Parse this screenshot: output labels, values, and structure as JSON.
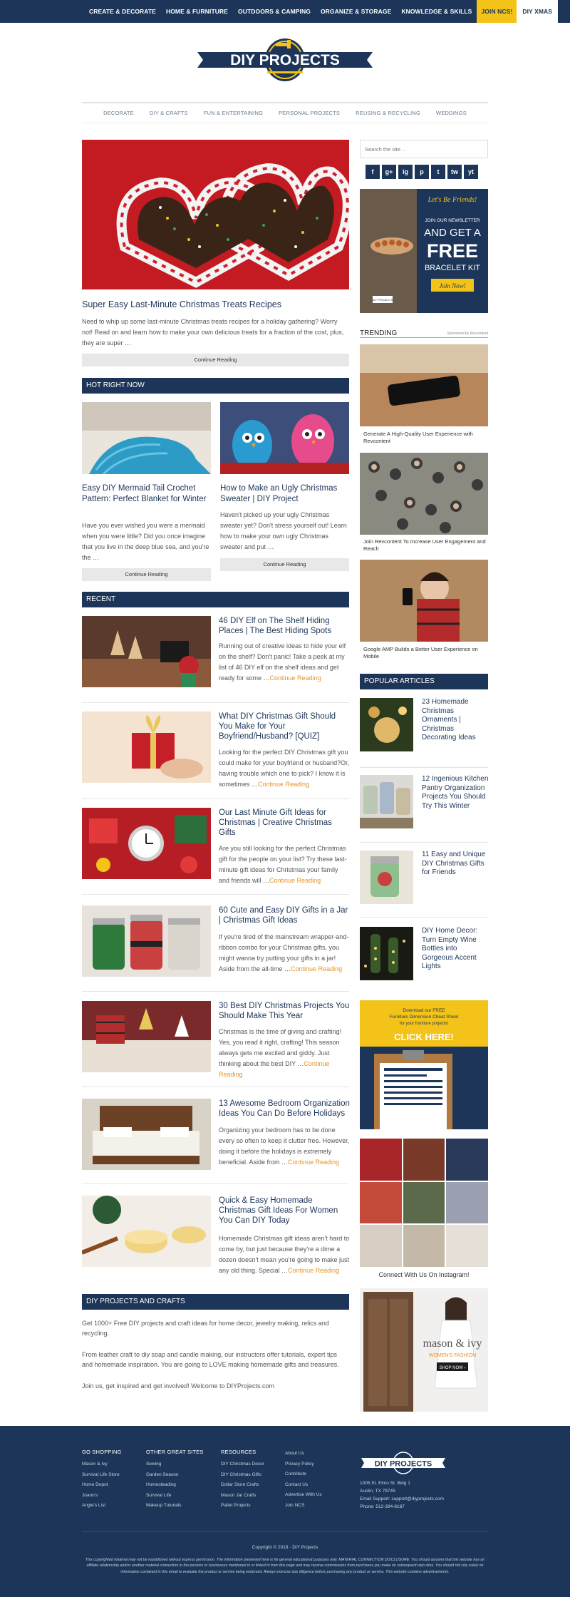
{
  "topnav": {
    "items": [
      "CREATE & DECORATE",
      "HOME & FURNITURE",
      "OUTDOORS & CAMPING",
      "ORGANIZE & STORAGE",
      "KNOWLEDGE & SKILLS"
    ],
    "join": "JOIN NCS!",
    "xmas": "DIY XMAS"
  },
  "logo": {
    "text": "DIY PROJECTS"
  },
  "mainnav": [
    "DECORATE",
    "DIY & CRAFTS",
    "FUN & ENTERTAINING",
    "PERSONAL PROJECTS",
    "REUSING & RECYCLING",
    "WEDDINGS"
  ],
  "hero": {
    "title": "Super Easy Last-Minute Christmas Treats Recipes",
    "excerpt": "Need to whip up some last-minute Christmas treats recipes for a holiday gathering? Worry not! Read on and learn how to make your own delicious treats for a fraction of the cost, plus, they are super …",
    "button": "Continue Reading"
  },
  "hot": {
    "heading": "HOT RIGHT NOW",
    "items": [
      {
        "title": "Easy DIY Mermaid Tail Crochet Pattern: Perfect Blanket for Winter",
        "excerpt": "Have you ever wished you were a mermaid when you were little? Did you once imagine that you live in the deep blue sea, and you're the …",
        "button": "Continue Reading"
      },
      {
        "title": "How to Make an Ugly Christmas Sweater | DIY Project",
        "excerpt": "Haven't picked up your ugly Christmas sweater yet? Don't stress yourself out! Learn how to make your own ugly Christmas sweater and put …",
        "button": "Continue Reading"
      }
    ]
  },
  "recent": {
    "heading": "RECENT",
    "items": [
      {
        "title": "46 DIY Elf on The Shelf Hiding Places | The Best Hiding Spots",
        "excerpt": "Running out of creative ideas to hide your elf on the shelf? Don't panic! Take a peek at my list of 46 DIY elf on the shelf ideas and get ready for some …",
        "more": "Continue Reading"
      },
      {
        "title": "What DIY Christmas Gift Should You Make for Your Boyfriend/Husband? [QUIZ]",
        "excerpt": "Looking for the perfect DIY Christmas gift you could make for your boyfriend or husband?Or, having trouble which one to pick? I know it is sometimes …",
        "more": "Continue Reading"
      },
      {
        "title": "Our Last Minute Gift Ideas for Christmas | Creative Christmas Gifts",
        "excerpt": "Are you still looking for the perfect Christmas gift for the people on your list? Try these last-minute gift ideas for Christmas your family and friends will …",
        "more": "Continue Reading"
      },
      {
        "title": "60 Cute and Easy DIY Gifts in a Jar | Christmas Gift Ideas",
        "excerpt": "If you're tired of the mainstream wrapper-and-ribbon combo for your Christmas gifts, you might wanna try putting your gifts in a jar! Aside from the all-time …",
        "more": "Continue Reading"
      },
      {
        "title": "30 Best DIY Christmas Projects You Should Make This Year",
        "excerpt": "Christmas is the time of giving and crafting! Yes, you read it right, crafting! This season always gets me excited and giddy. Just thinking about the best DIY …",
        "more": "Continue Reading"
      },
      {
        "title": "13 Awesome Bedroom Organization Ideas You Can Do Before Holidays",
        "excerpt": "Organizing your bedroom has to be done every so often to keep it clutter free. However, doing it before the holidays is extremely beneficial. Aside from …",
        "more": "Continue Reading"
      },
      {
        "title": "Quick & Easy Homemade Christmas Gift Ideas For Women You Can DIY Today",
        "excerpt": "Homemade Christmas gift ideas aren't hard to come by, but just because they're a dime a dozen doesn't mean you're going to make just any old thing. Special …",
        "more": "Continue Reading"
      }
    ]
  },
  "about": {
    "heading": "DIY PROJECTS AND CRAFTS",
    "p1": "Get 1000+ Free DIY projects and craft ideas for home decor, jewelry making, relics and recycling.",
    "p2": "From leather craft to diy soap and candle making, our instructors offer tutorials, expert tips and homemade inspiration. You are going to LOVE making homemade gifts and treasures.",
    "p3": "Join us, get inspired and get involved! Welcome to DIYProjects.com"
  },
  "sidebar": {
    "search_placeholder": "Search the site ..",
    "social": [
      "f",
      "g+",
      "ig",
      "p",
      "t",
      "tw",
      "yt"
    ],
    "ad_friends": {
      "line1": "Let's Be Friends!",
      "line2": "JOIN OUR NEWSLETTER",
      "line3": "AND GET A",
      "line4": "FREE",
      "line5": "BRACELET KIT",
      "cta": "Join Now!"
    },
    "trending": {
      "heading": "TRENDING",
      "sponsor": "Sponsored by Revcontent",
      "items": [
        "Generate A High-Quality User Experience with Revcontent",
        "Join Revcontent To Increase User Engagement and Reach",
        "Google AMP Builds a Better User Experience on Mobile"
      ]
    },
    "popular": {
      "heading": "POPULAR ARTICLES",
      "items": [
        "23 Homemade Christmas Ornaments | Christmas Decorating Ideas",
        "12 Ingenious Kitchen Pantry Organization Projects You Should Try This Winter",
        "11 Easy and Unique DIY Christmas Gifts for Friends",
        "DIY Home Decor: Turn Empty Wine Bottles into Gorgeous Accent Lights"
      ]
    },
    "ad_click": {
      "line1": "Download our FREE",
      "line2": "Furniture Dimension Cheat Sheet",
      "line3": "for your furniture projects!",
      "cta": "CLICK HERE!"
    },
    "instagram_caption": "Connect With Us On Instagram!",
    "ad_mason": {
      "brand": "mason & ivy",
      "sub": "WOMEN'S FASHION",
      "cta": "SHOP NOW ›"
    }
  },
  "footer": {
    "columns": [
      {
        "heading": "GO SHOPPING",
        "links": [
          "Mason & Ivy",
          "Survival Life Store",
          "Home Depot",
          "Joann's",
          "Angie's List"
        ]
      },
      {
        "heading": "OTHER GREAT SITES",
        "links": [
          "Sewing",
          "Garden Season",
          "Homesteading",
          "Survival Life",
          "Makeup Tutorials"
        ]
      },
      {
        "heading": "RESOURCES",
        "links": [
          "DIY Christmas Decor",
          "DIY Christmas Gifts",
          "Dollar Store Crafts",
          "Mason Jar Crafts",
          "Pallet Projects"
        ]
      },
      {
        "heading": "",
        "links": [
          "About Us",
          "Privacy Policy",
          "Contribute",
          "Contact Us",
          "Advertise With Us",
          "Join NCS"
        ]
      }
    ],
    "logo": "DIY PROJECTS",
    "address": [
      "1005 St. Elmo St. Bldg 1",
      "Austin, TX 78745",
      "Email Support: support@diyprojects.com",
      "Phone: 512-394-8187"
    ],
    "copyright": "Copyright © 2018 · DIY Projects",
    "disclaimer": "This copyrighted material may not be republished without express permission. The information presented here is for general educational purposes only. MATERIAL CONNECTION DISCLOSURE: You should assume that this website has an affiliate relationship and/or another material connection to the persons or businesses mentioned in or linked to from this page and may receive commissions from purchases you make on subsequent web sites. You should not rely solely on information contained in this email to evaluate the product or service being endorsed. Always exercise due diligence before purchasing any product or service. This website contains advertisements."
  }
}
